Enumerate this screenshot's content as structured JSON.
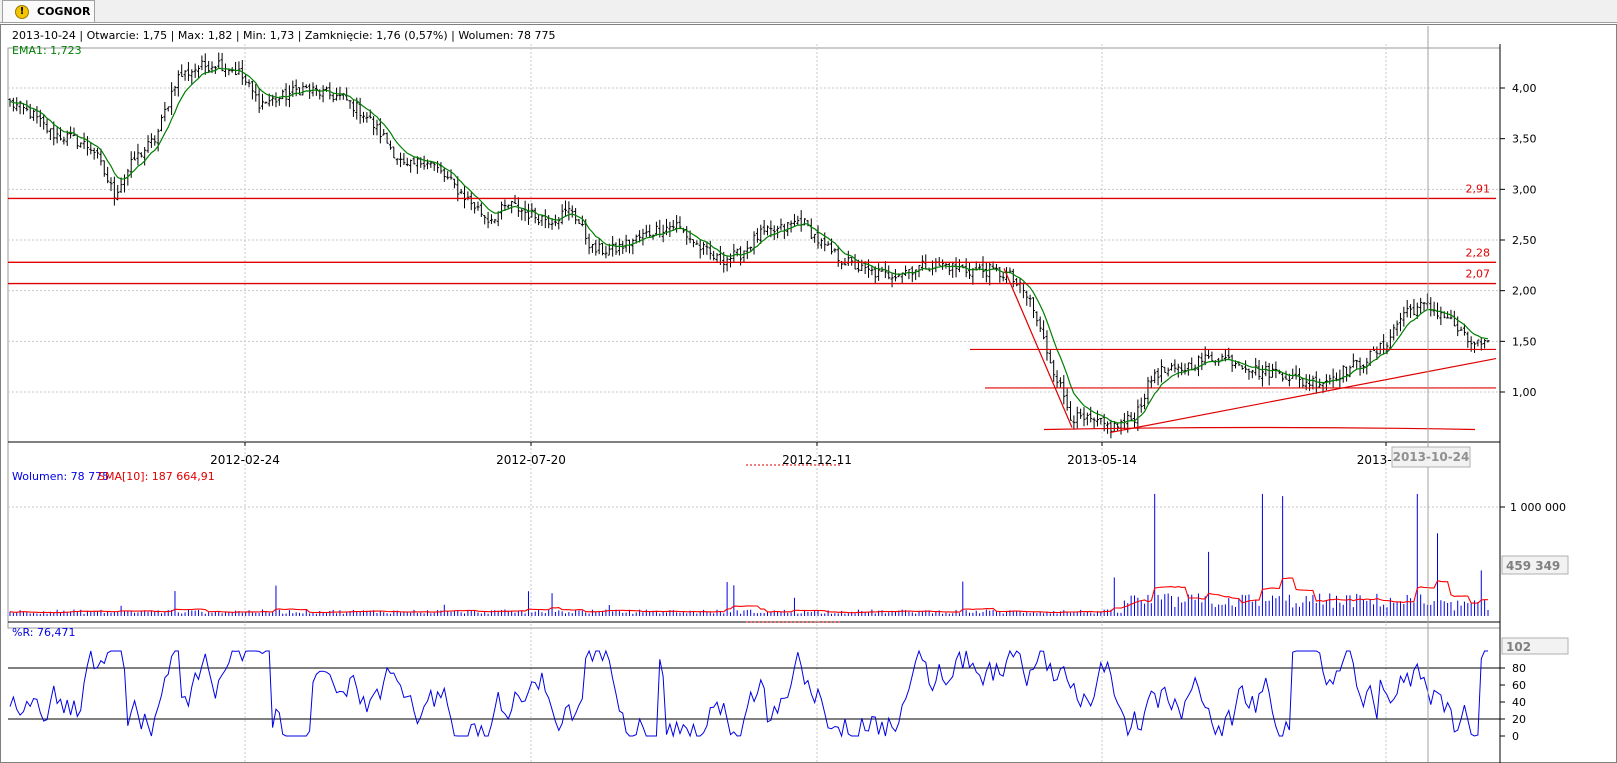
{
  "tab": {
    "label": "COGNOR",
    "icon": "warning-icon"
  },
  "colors": {
    "candle": "#000000",
    "ema": "#008000",
    "support_lines": "#e00000",
    "volume": "#0000e6",
    "volume_sma": "#ff0000",
    "williams_r": "#0000e6"
  },
  "price_panel": {
    "info_line": "2013-10-24 | Otwarcie: 1,75 | Max: 1,82 | Min: 1,73 | Zamknięcie: 1,76 (0,57%)  | Wolumen: 78 775",
    "ema_label": "EMA1: 1,723"
  },
  "volume_panel": {
    "label_volume": "Wolumen: 78 775",
    "label_sma": "SMA[10]: 187 664,91",
    "cursor_value": "459 349"
  },
  "indicator_panel": {
    "label": "%R: 76,471",
    "cursor_value": "102"
  },
  "x_axis": {
    "cursor_date": "2013-10-24"
  },
  "chart_data": [
    {
      "type": "ohlc",
      "x_labels": [
        "2012-02-24",
        "2012-07-20",
        "2012-12-11",
        "2013-05-14",
        "2013-10-24"
      ],
      "y_ticks": [
        "1,00",
        "1,50",
        "2,00",
        "2,50",
        "3,00",
        "3,50",
        "4,00"
      ],
      "y_tick_values": [
        1.0,
        1.5,
        2.0,
        2.5,
        3.0,
        3.5,
        4.0
      ],
      "ylim": [
        0.5,
        4.45
      ],
      "grid": true,
      "price_waypoints": [
        3.85,
        3.75,
        3.55,
        3.5,
        3.4,
        2.95,
        3.3,
        3.5,
        4.1,
        4.2,
        4.25,
        4.15,
        3.85,
        3.9,
        4.0,
        3.95,
        3.9,
        3.75,
        3.5,
        3.2,
        3.3,
        3.1,
        2.9,
        2.7,
        2.85,
        2.75,
        2.7,
        2.8,
        2.4,
        2.4,
        2.5,
        2.6,
        2.65,
        2.45,
        2.3,
        2.35,
        2.55,
        2.6,
        2.7,
        2.45,
        2.3,
        2.2,
        2.15,
        2.2,
        2.25,
        2.25,
        2.2,
        2.2,
        2.15,
        1.9,
        1.3,
        0.75,
        0.7,
        0.65,
        0.75,
        1.2,
        1.2,
        1.3,
        1.35,
        1.3,
        1.2,
        1.2,
        1.1,
        1.1,
        1.2,
        1.3,
        1.45,
        1.8,
        1.85,
        1.75,
        1.5,
        1.45
      ],
      "ema_label": "EMA1: 1,723",
      "horizontal_levels": [
        {
          "value": 2.91,
          "label": "2,91"
        },
        {
          "value": 2.28,
          "label": "2,28"
        },
        {
          "value": 2.07,
          "label": "2,07"
        }
      ],
      "channel_levels": [
        1.42,
        1.04
      ]
    },
    {
      "type": "bar",
      "series": [
        {
          "name": "Wolumen",
          "last": 78775
        },
        {
          "name": "SMA[10]",
          "last": 187664.91
        }
      ],
      "y_ticks": [
        "1 000 000"
      ],
      "cursor_value": "459 349"
    },
    {
      "type": "line",
      "series": [
        {
          "name": "%R",
          "last": 76.471
        }
      ],
      "y_ticks": [
        "0",
        "20",
        "40",
        "60",
        "80"
      ],
      "ylim": [
        0,
        102
      ],
      "levels": [
        20,
        80
      ]
    }
  ]
}
